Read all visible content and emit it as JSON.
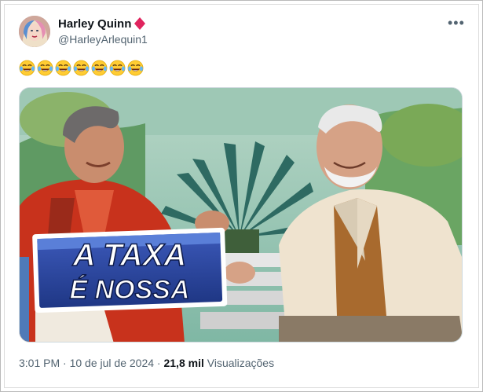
{
  "author": {
    "display_name": "Harley Quinn",
    "handle": "@HarleyArlequin1",
    "badge_icon": "red-diamond-icon",
    "badge_color": "#e0245e"
  },
  "tweet": {
    "text_emojis": [
      "😂",
      "😂",
      "😂",
      "😂",
      "😂",
      "😂",
      "😂"
    ],
    "media_caption_line1": "A TAXA",
    "media_caption_line2": "É NOSSA"
  },
  "meta": {
    "time": "3:01 PM",
    "separator": " · ",
    "date": "10 de jul de 2024",
    "views_count": "21,8 mil",
    "views_label": "Visualizações"
  },
  "menu_icon": "more-options-icon"
}
